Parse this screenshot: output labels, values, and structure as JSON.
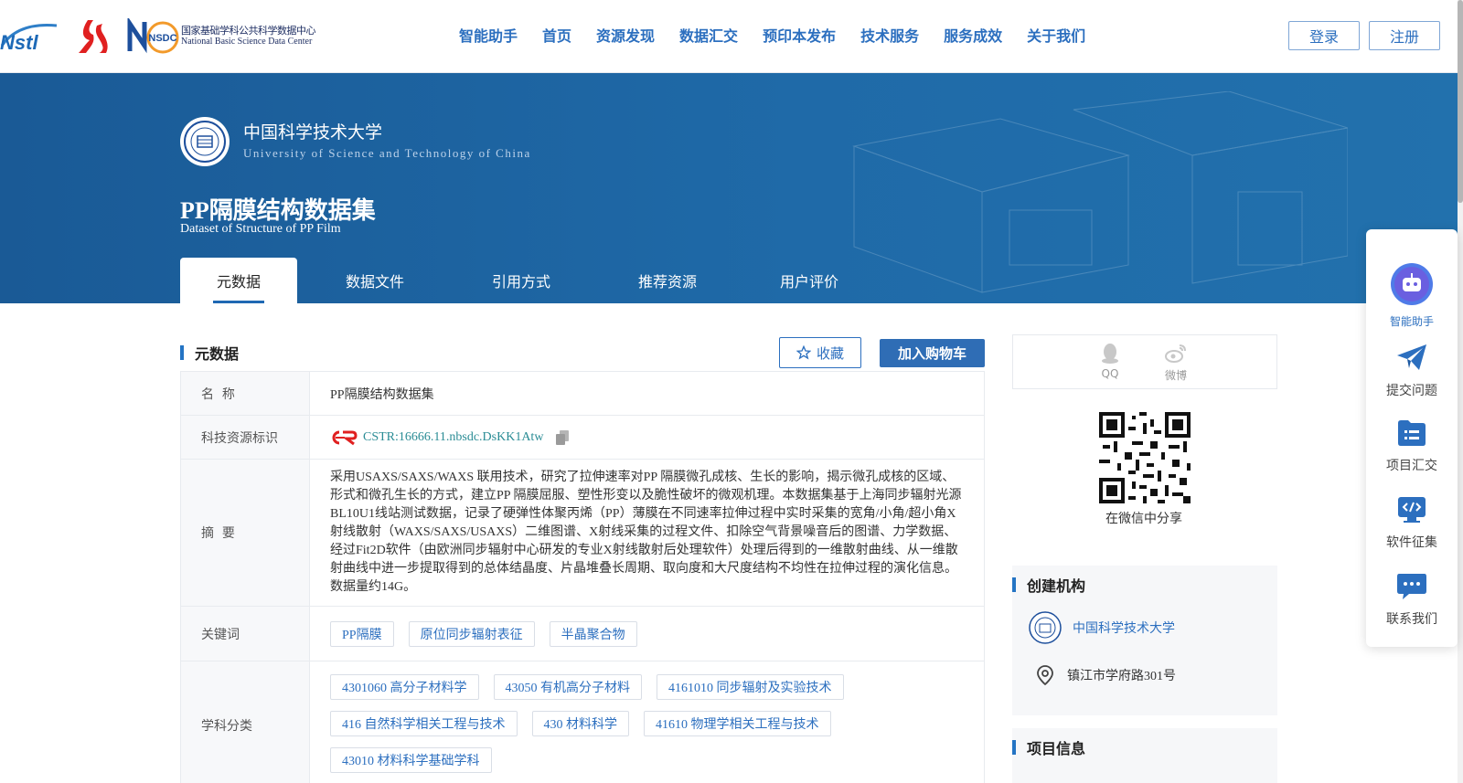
{
  "header": {
    "logos": {
      "nstl_text": "Nstl",
      "nsdc_mark": "NSDC",
      "nsdc_cn": "国家基础学科公共科学数据中心",
      "nsdc_en": "National Basic Science Data Center"
    },
    "nav": [
      "智能助手",
      "首页",
      "资源发现",
      "数据汇交",
      "预印本发布",
      "技术服务",
      "服务成效",
      "关于我们"
    ],
    "login": "登录",
    "register": "注册"
  },
  "banner": {
    "institution_cn": "中国科学技术大学",
    "institution_en": "University of Science and Technology of China",
    "title": "PP隔膜结构数据集",
    "title_en": "Dataset of Structure of PP Film",
    "tabs": [
      "元数据",
      "数据文件",
      "引用方式",
      "推荐资源",
      "用户评价"
    ],
    "active_tab": "元数据"
  },
  "metadata": {
    "section_title": "元数据",
    "favorite": "收藏",
    "add_to_cart": "加入购物车",
    "rows": {
      "name_label": "名  称",
      "name": "PP隔膜结构数据集",
      "identifier_label": "科技资源标识",
      "identifier": "CSTR:16666.11.nbsdc.DsKK1Atw",
      "abstract_label": "摘  要",
      "abstract": "采用USAXS/SAXS/WAXS 联用技术，研究了拉伸速率对PP 隔膜微孔成核、生长的影响，揭示微孔成核的区域、形式和微孔生长的方式，建立PP 隔膜屈服、塑性形变以及脆性破坏的微观机理。本数据集基于上海同步辐射光源BL10U1线站测试数据，记录了硬弹性体聚丙烯（PP）薄膜在不同速率拉伸过程中实时采集的宽角/小角/超小角X射线散射（WAXS/SAXS/USAXS）二维图谱、X射线采集的过程文件、扣除空气背景噪音后的图谱、力学数据、经过Fit2D软件（由欧洲同步辐射中心研发的专业X射线散射后处理软件）处理后得到的一维散射曲线、从一维散射曲线中进一步提取得到的总体结晶度、片晶堆叠长周期、取向度和大尺度结构不均性在拉伸过程的演化信息。数据量约14G。",
      "keywords_label": "关键词",
      "keywords": [
        "PP隔膜",
        "原位同步辐射表征",
        "半晶聚合物"
      ],
      "subjects_label": "学科分类",
      "subjects": [
        "4301060 高分子材料学",
        "43050 有机高分子材料",
        "4161010 同步辐射及实验技术",
        "416 自然科学相关工程与技术",
        "430 材料科学",
        "41610 物理学相关工程与技术",
        "43010 材料科学基础学科"
      ]
    }
  },
  "sidebar": {
    "share": {
      "qq": "QQ",
      "weibo": "微博"
    },
    "qr_caption": "在微信中分享",
    "creator_title": "创建机构",
    "creator_name": "中国科学技术大学",
    "address": "镇江市学府路301号",
    "project_title": "项目信息"
  },
  "float_toolbar": [
    "智能助手",
    "提交问题",
    "项目汇交",
    "软件征集",
    "联系我们"
  ],
  "colors": {
    "accent": "#2c6fbf",
    "banner": "#1f64a4",
    "cstr": "#2a8c95"
  }
}
